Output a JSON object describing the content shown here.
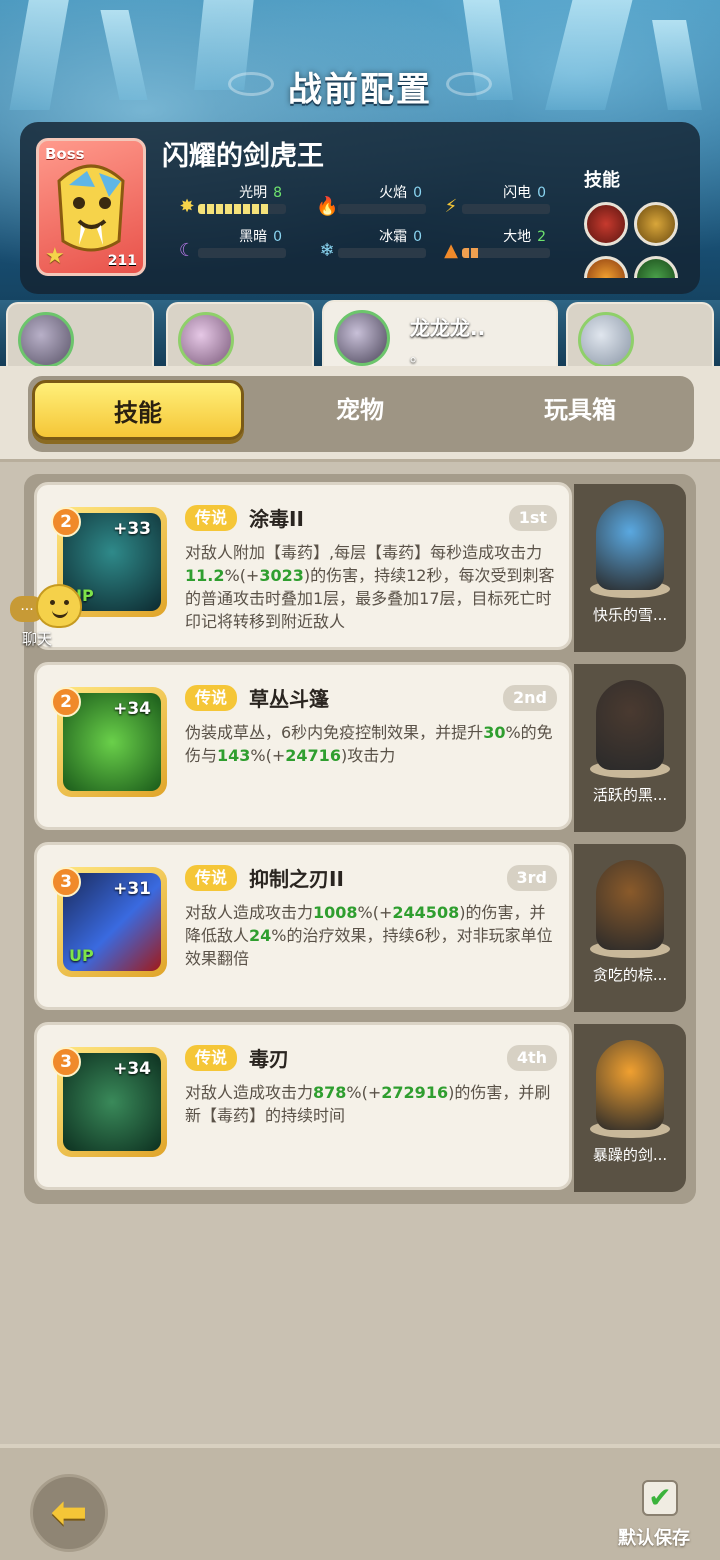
{
  "header": {
    "title": "战前配置"
  },
  "boss": {
    "tag": "Boss",
    "level": "211",
    "name": "闪耀的剑虎王",
    "elements": [
      {
        "name": "光明",
        "value": "8",
        "fill": 0.8,
        "icon": "sun-icon"
      },
      {
        "name": "火焰",
        "value": "0",
        "fill": 0,
        "icon": "flame-icon"
      },
      {
        "name": "闪电",
        "value": "0",
        "fill": 0,
        "icon": "lightning-icon"
      },
      {
        "name": "黑暗",
        "value": "0",
        "fill": 0,
        "icon": "moon-icon"
      },
      {
        "name": "冰霜",
        "value": "0",
        "fill": 0,
        "icon": "snowflake-icon"
      },
      {
        "name": "大地",
        "value": "2",
        "fill": 0.2,
        "icon": "mountain-icon"
      }
    ],
    "skills_label": "技能"
  },
  "team": [
    {
      "name": "",
      "sub": ""
    },
    {
      "name": "",
      "sub": ""
    },
    {
      "name": "龙龙龙..",
      "sub": "。"
    },
    {
      "name": "",
      "sub": ""
    }
  ],
  "tabs": [
    {
      "label": "技能",
      "active": true
    },
    {
      "label": "宠物",
      "active": false
    },
    {
      "label": "玩具箱",
      "active": false
    }
  ],
  "skills": [
    {
      "rank": "2",
      "plus": "+33",
      "up": "UP",
      "rarity": "传说",
      "name": "涂毒II",
      "order": "1st",
      "desc_parts": [
        "对敌人附加【毒药】,每层【毒药】每秒造成攻击力",
        "11.2",
        "%(+",
        "3023",
        ")的伤害，持续12秒，每次受到刺客的普通攻击时叠加1层，最多叠加17层，目标死亡时印记将转移到附近敌人"
      ],
      "pet": "快乐的雪..."
    },
    {
      "rank": "2",
      "plus": "+34",
      "up": "",
      "rarity": "传说",
      "name": "草丛斗篷",
      "order": "2nd",
      "desc_parts": [
        "伪装成草丛，6秒内免疫控制效果，并提升",
        "30",
        "%的免伤与",
        "143",
        "%(+",
        "24716",
        ")攻击力"
      ],
      "pet": "活跃的黑..."
    },
    {
      "rank": "3",
      "plus": "+31",
      "up": "UP",
      "rarity": "传说",
      "name": "抑制之刃II",
      "order": "3rd",
      "desc_parts": [
        "对敌人造成攻击力",
        "1008",
        "%(+",
        "244508",
        ")的伤害，并降低敌人",
        "24",
        "%的治疗效果，持续6秒，对非玩家单位效果翻倍"
      ],
      "pet": "贪吃的棕..."
    },
    {
      "rank": "3",
      "plus": "+34",
      "up": "",
      "rarity": "传说",
      "name": "毒刃",
      "order": "4th",
      "desc_parts": [
        "对敌人造成攻击力",
        "878",
        "%(+",
        "272916",
        ")的伤害，并刷新【毒药】的持续时间"
      ],
      "pet": "暴躁的剑..."
    }
  ],
  "chat": {
    "label": "聊天",
    "dots": "..."
  },
  "footer": {
    "back_icon": "back-arrow-icon",
    "save_label": "默认保存"
  },
  "colors": {
    "accent": "#f5c637",
    "highlight": "#2f9e2f",
    "legend": "#f5c637"
  }
}
